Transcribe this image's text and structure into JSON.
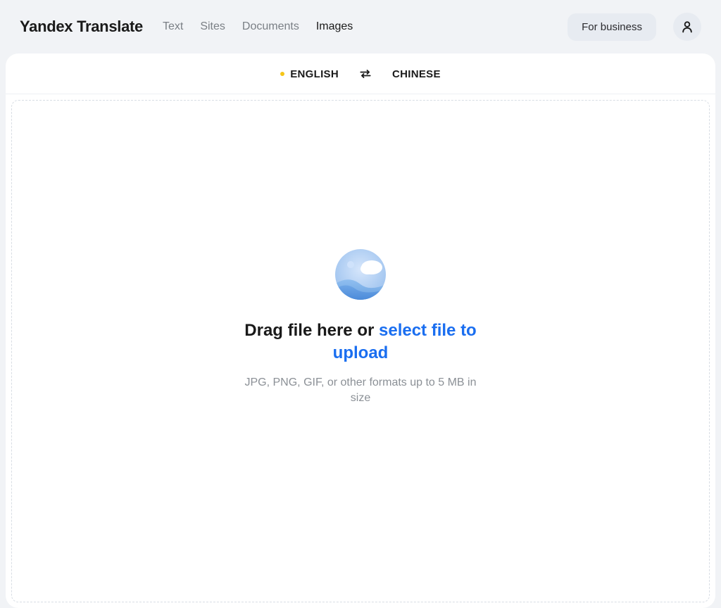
{
  "header": {
    "logo_brand": "Yandex",
    "logo_product": "Translate",
    "tabs": {
      "text": "Text",
      "sites": "Sites",
      "documents": "Documents",
      "images": "Images"
    },
    "business_label": "For business"
  },
  "langbar": {
    "source": "ENGLISH",
    "target": "CHINESE"
  },
  "dropzone": {
    "drag_prefix": "Drag file here or ",
    "drag_link": "select file to upload",
    "hint": "JPG, PNG, GIF, or other formats up to 5 MB in size"
  }
}
